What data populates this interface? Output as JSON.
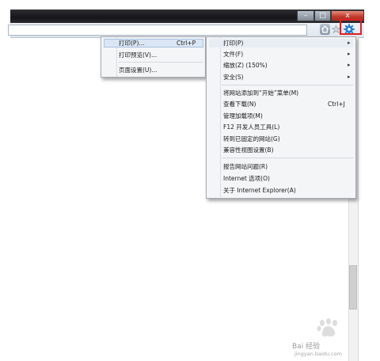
{
  "window": {
    "min_glyph": "–",
    "max_glyph": "□",
    "close_glyph": "x"
  },
  "icons": {
    "home": "home-icon",
    "star": "star-icon",
    "gear": "gear-icon",
    "accent": "#e02020",
    "gear_color": "#2a7fd0"
  },
  "sub_menu": {
    "items": [
      {
        "label": "打印(P)...",
        "shortcut": "Ctrl+P"
      },
      {
        "label": "打印预览(V)...",
        "shortcut": ""
      },
      {
        "label": "页面设置(U)...",
        "shortcut": ""
      }
    ]
  },
  "main_menu": {
    "items": [
      {
        "label": "打印(P)",
        "shortcut": "",
        "has_arrow": true
      },
      {
        "label": "文件(F)",
        "shortcut": "",
        "has_arrow": true
      },
      {
        "label": "缩放(Z) (150%)",
        "shortcut": "",
        "has_arrow": true
      },
      {
        "label": "安全(S)",
        "shortcut": "",
        "has_arrow": true
      },
      {
        "label": "将网站添加到“开始”菜单(M)",
        "shortcut": "",
        "has_arrow": false
      },
      {
        "label": "查看下载(N)",
        "shortcut": "Ctrl+J",
        "has_arrow": false
      },
      {
        "label": "管理加载项(M)",
        "shortcut": "",
        "has_arrow": false
      },
      {
        "label": "F12 开发人员工具(L)",
        "shortcut": "",
        "has_arrow": false
      },
      {
        "label": "转到已固定的网站(G)",
        "shortcut": "",
        "has_arrow": false
      },
      {
        "label": "兼容性视图设置(B)",
        "shortcut": "",
        "has_arrow": false
      },
      {
        "label": "报告网站问题(R)",
        "shortcut": "",
        "has_arrow": false
      },
      {
        "label": "Internet 选项(O)",
        "shortcut": "",
        "has_arrow": false
      },
      {
        "label": "关于 Internet Explorer(A)",
        "shortcut": "",
        "has_arrow": false
      }
    ],
    "arrow_glyph": "▸"
  },
  "watermark": {
    "text": "Bai 经验",
    "url": "jingyan.baidu.com"
  }
}
